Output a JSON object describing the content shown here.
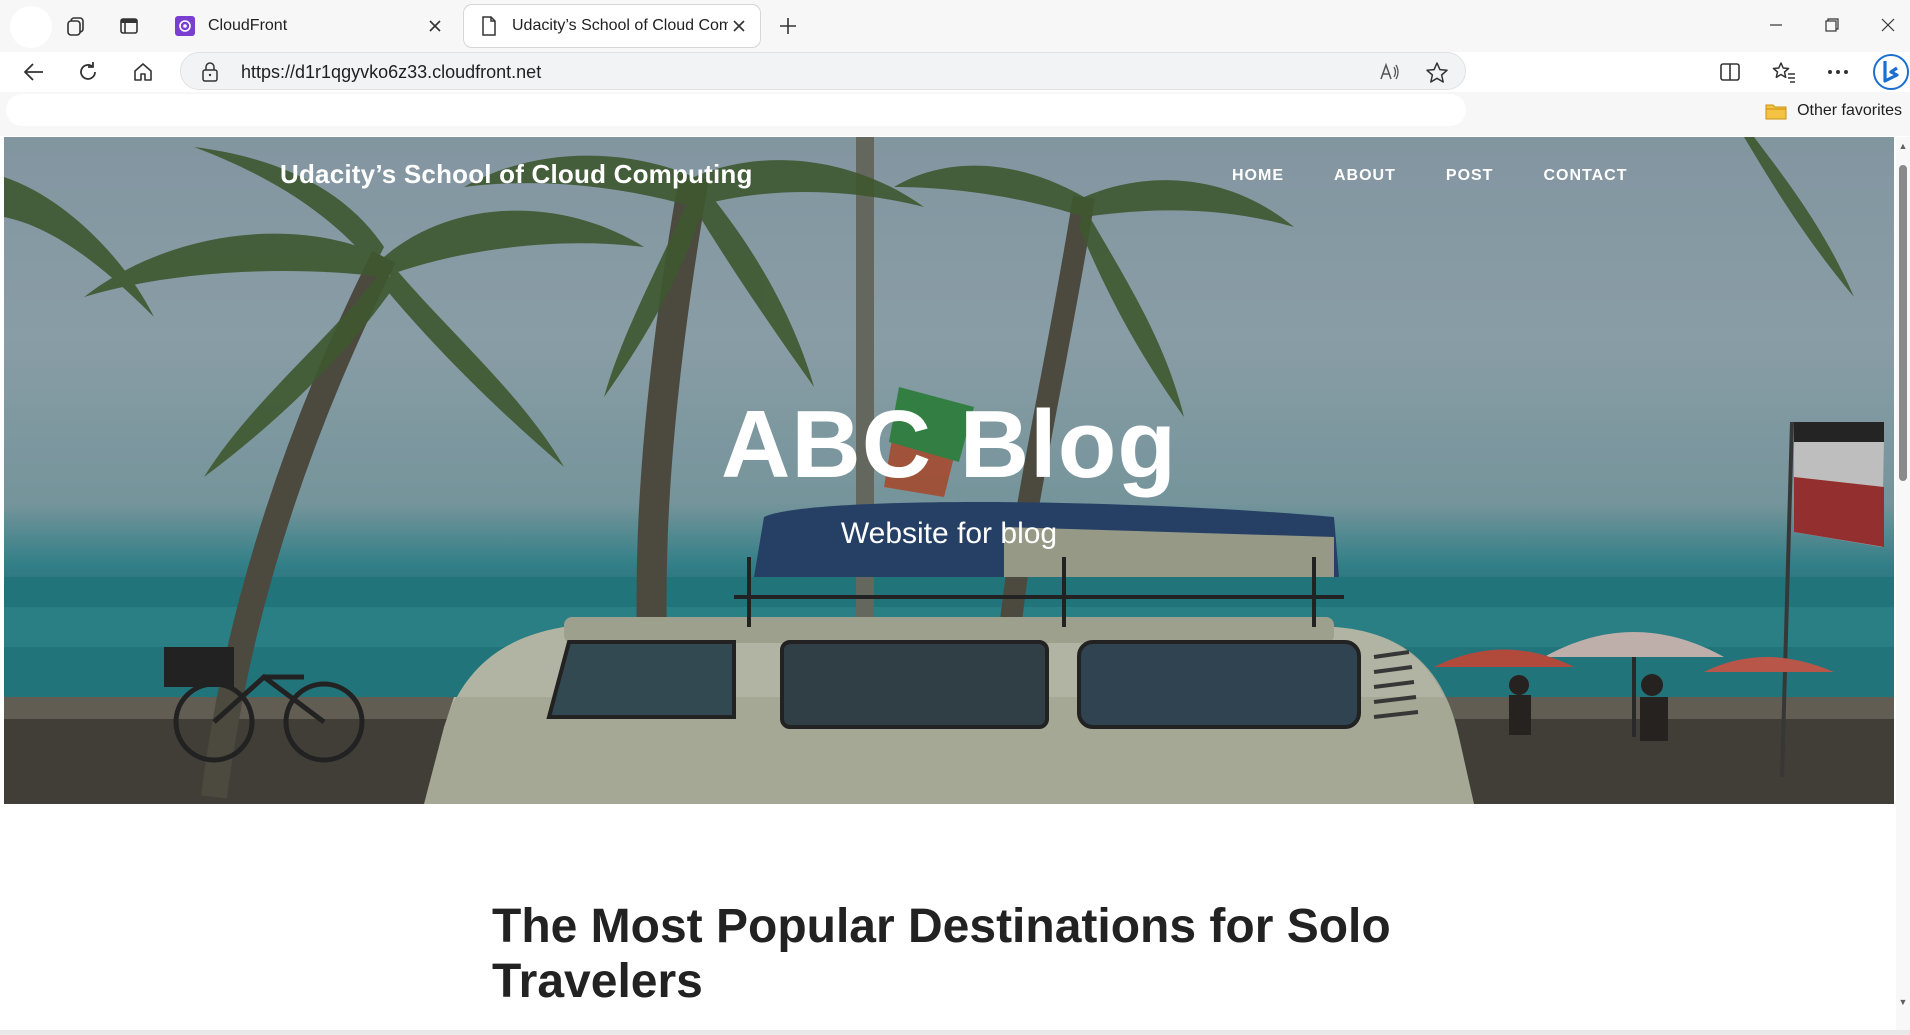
{
  "browser": {
    "tabs": [
      {
        "label": "CloudFront",
        "active": false
      },
      {
        "label": "Udacity’s School of Cloud Comp",
        "active": true
      }
    ],
    "address": {
      "url": "https://d1r1qgyvko6z33.cloudfront.net"
    },
    "favorites": {
      "other_label": "Other favorites"
    },
    "icons": {
      "workspaces": "workspaces-icon",
      "tab_actions": "tab-actions-icon",
      "new_tab": "plus-icon",
      "back": "back-arrow-icon",
      "refresh": "refresh-icon",
      "home": "home-icon",
      "lock": "lock-icon",
      "read_aloud": "read-aloud-icon",
      "favorite": "star-icon",
      "split": "split-screen-icon",
      "favorites_list": "favorites-icon",
      "more": "more-icon",
      "copilot": "copilot-icon"
    },
    "accent": "#7a3fd1"
  },
  "site": {
    "brand": "Udacity’s School of Cloud Computing",
    "nav": [
      "HOME",
      "ABOUT",
      "POST",
      "CONTACT"
    ],
    "hero": {
      "title": "ABC Blog",
      "subtitle": "Website for blog"
    },
    "post": {
      "title": "The Most Popular Destinations for Solo Travelers"
    }
  }
}
